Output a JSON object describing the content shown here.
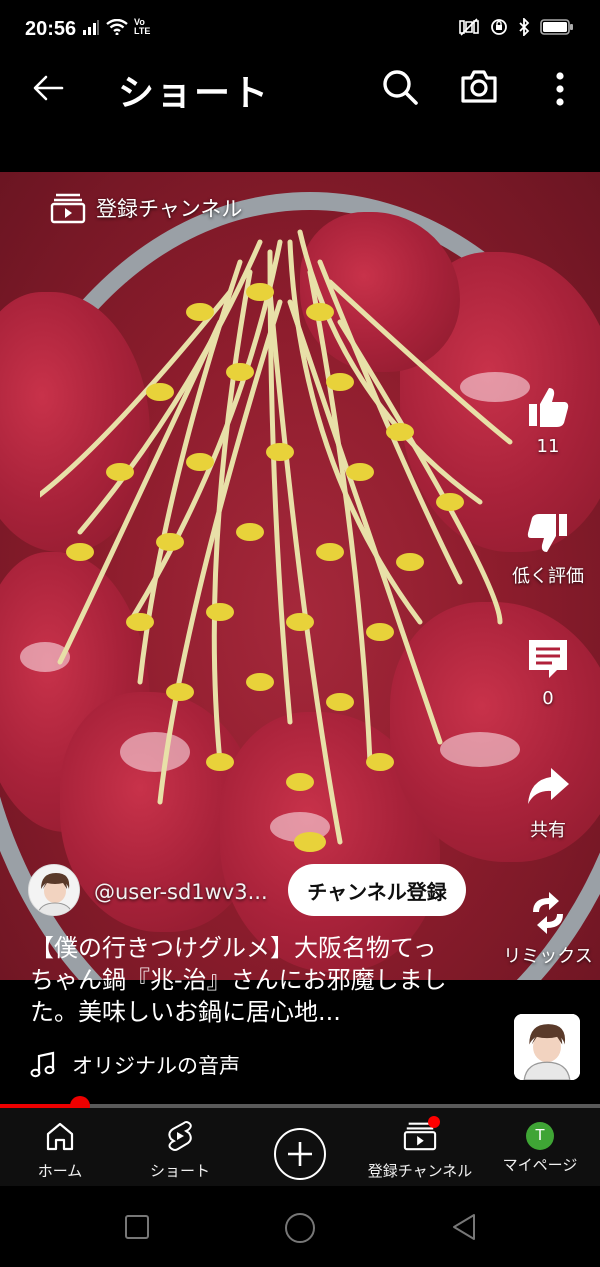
{
  "status_bar": {
    "time": "20:56",
    "volte": [
      "Vo",
      "LTE"
    ],
    "icons": [
      "signal-icon",
      "wifi-icon",
      "volte-icon",
      "mute-icon",
      "alarm-icon",
      "bluetooth-icon",
      "battery-icon"
    ]
  },
  "header": {
    "title": "ショート",
    "icons": [
      "back-arrow-icon",
      "search-icon",
      "camera-icon",
      "more-vert-icon"
    ]
  },
  "video": {
    "subscriptions_label": "登録チャンネル",
    "channel_handle": "@user-sd1wv3...",
    "subscribe_label": "チャンネル登録",
    "title": "【僕の行きつけグルメ】大阪名物てっちゃん鍋『兆-治』さんにお邪魔しました。美味しいお鍋に居心地...",
    "audio_label": "オリジナルの音声",
    "progress": 0.133
  },
  "actions": {
    "like_count": "11",
    "dislike_label": "低く評価",
    "comment_count": "0",
    "share_label": "共有",
    "remix_label": "リミックス"
  },
  "bottom_nav": {
    "home": "ホーム",
    "shorts": "ショート",
    "subscriptions": "登録チャンネル",
    "my_page": "マイページ",
    "avatar_letter": "T"
  },
  "colors": {
    "accent": "#ff0000",
    "avatar_bg": "#3fa535",
    "background": "#000000"
  }
}
